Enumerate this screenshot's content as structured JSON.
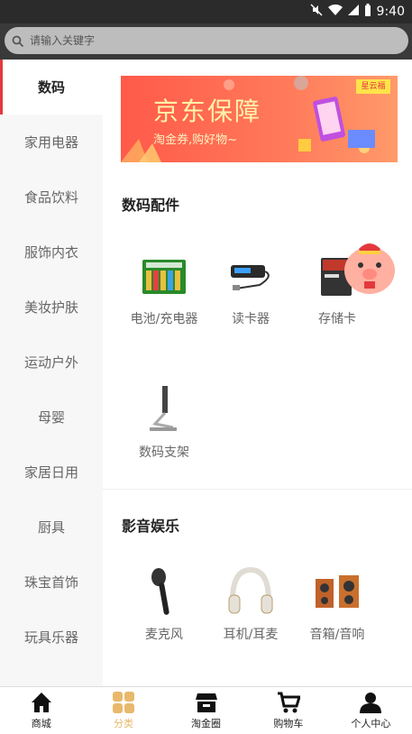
{
  "status_bar": {
    "time": "9:40"
  },
  "search": {
    "placeholder": "请输入关键字"
  },
  "sidebar": {
    "items": [
      {
        "label": "数码",
        "active": true
      },
      {
        "label": "家用电器"
      },
      {
        "label": "食品饮料"
      },
      {
        "label": "服饰内衣"
      },
      {
        "label": "美妆护肤"
      },
      {
        "label": "运动户外"
      },
      {
        "label": "母婴"
      },
      {
        "label": "家居日用"
      },
      {
        "label": "厨具"
      },
      {
        "label": "珠宝首饰"
      },
      {
        "label": "玩具乐器"
      }
    ]
  },
  "banner": {
    "title": "京东保障",
    "subtitle": "淘金券,购好物~",
    "tag": "星云福"
  },
  "sections": [
    {
      "title": "数码配件",
      "products": [
        {
          "label": "电池/充电器",
          "icon": "battery-charger-icon"
        },
        {
          "label": "读卡器",
          "icon": "card-reader-icon"
        },
        {
          "label": "存储卡",
          "icon": "memory-card-icon"
        },
        {
          "label": "数码支架",
          "icon": "device-stand-icon"
        }
      ]
    },
    {
      "title": "影音娱乐",
      "products": [
        {
          "label": "麦克风",
          "icon": "microphone-icon"
        },
        {
          "label": "耳机/耳麦",
          "icon": "headphones-icon"
        },
        {
          "label": "音箱/音响",
          "icon": "speaker-icon"
        }
      ]
    }
  ],
  "tabbar": {
    "items": [
      {
        "label": "商城",
        "icon": "home-icon"
      },
      {
        "label": "分类",
        "icon": "category-grid-icon",
        "active": true
      },
      {
        "label": "淘金圈",
        "icon": "store-icon"
      },
      {
        "label": "购物车",
        "icon": "cart-icon"
      },
      {
        "label": "个人中心",
        "icon": "user-icon"
      }
    ]
  },
  "colors": {
    "accent": "#e4393c",
    "active_tab": "#e8b96a",
    "header": "#3a3a3a"
  }
}
